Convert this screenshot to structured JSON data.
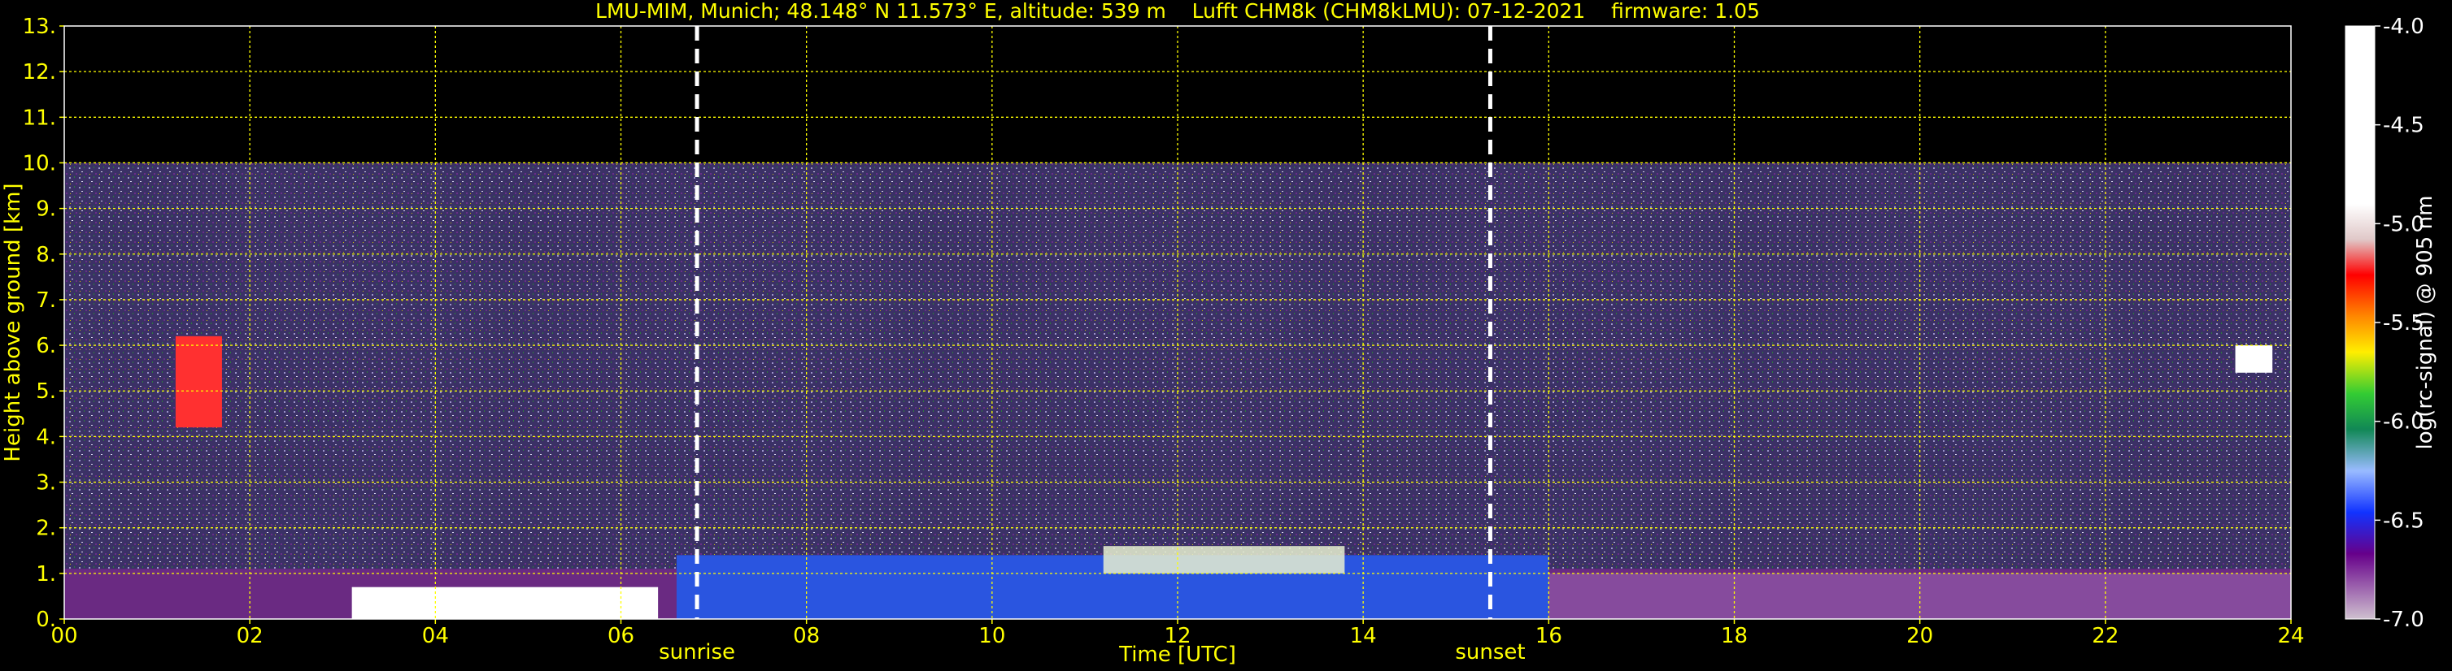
{
  "chart_data": {
    "type": "heatmap",
    "title": "LMU-MIM, Munich; 48.148° N 11.573° E, altitude: 539 m    Lufft CHM8k (CHM8kLMU): 07-12-2021    firmware: 1.05",
    "xlabel": "Time [UTC]",
    "ylabel": "Height above ground [km]",
    "xlim": [
      0,
      24
    ],
    "ylim": [
      0,
      13
    ],
    "x_ticks": [
      "00",
      "02",
      "04",
      "06",
      "08",
      "10",
      "12",
      "14",
      "16",
      "18",
      "20",
      "22",
      "24"
    ],
    "y_ticks": [
      "0.",
      "1.",
      "2.",
      "3.",
      "4.",
      "5.",
      "6.",
      "7.",
      "8.",
      "9.",
      "10.",
      "11.",
      "12.",
      "13."
    ],
    "grid": true,
    "measurement_top_km": 10,
    "events": [
      {
        "label": "sunrise",
        "time_utc": 6.82
      },
      {
        "label": "sunset",
        "time_utc": 15.37
      }
    ],
    "colorbar": {
      "label": "log(rc-signal) @ 905 nm",
      "range": [
        -7.0,
        -4.0
      ],
      "ticks": [
        "-4.0",
        "-4.5",
        "-5.0",
        "-5.5",
        "-6.0",
        "-6.5",
        "-7.0"
      ]
    }
  },
  "colors": {
    "text": "#ffff00",
    "grid": "#ffff00",
    "background": "#000000",
    "noise": "#4a3d78"
  }
}
